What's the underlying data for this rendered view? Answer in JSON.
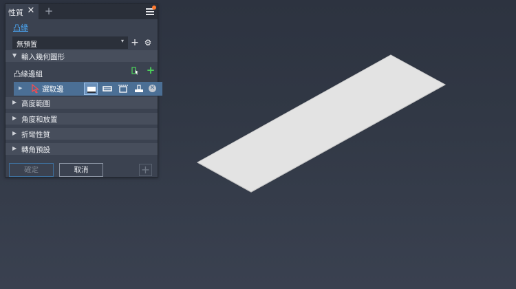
{
  "panel": {
    "tab_label": "性質",
    "tab_close_glyph": "✕",
    "tab_add_glyph": "+",
    "feature_name": "凸緣",
    "preset": {
      "value": "無預置",
      "caret": "▾"
    },
    "add_preset_glyph": "+",
    "gear_glyph": "⚙",
    "notification_color": "#ff7a2f",
    "sections": {
      "input_geometry": "輸入幾何圖形",
      "height_extents": "高度範圍",
      "angle_placement": "角度和放置",
      "bend_properties": "折彎性質",
      "corner_preset": "轉角預設"
    },
    "edge_group_label": "凸緣邊組",
    "select_edges_label": "選取邊",
    "clear_glyph": "✕",
    "buttons": {
      "ok": "確定",
      "cancel": "取消",
      "apply_glyph": "+"
    },
    "accent_color": "#4aa5f2",
    "selection_row_color": "#4b6f95"
  }
}
